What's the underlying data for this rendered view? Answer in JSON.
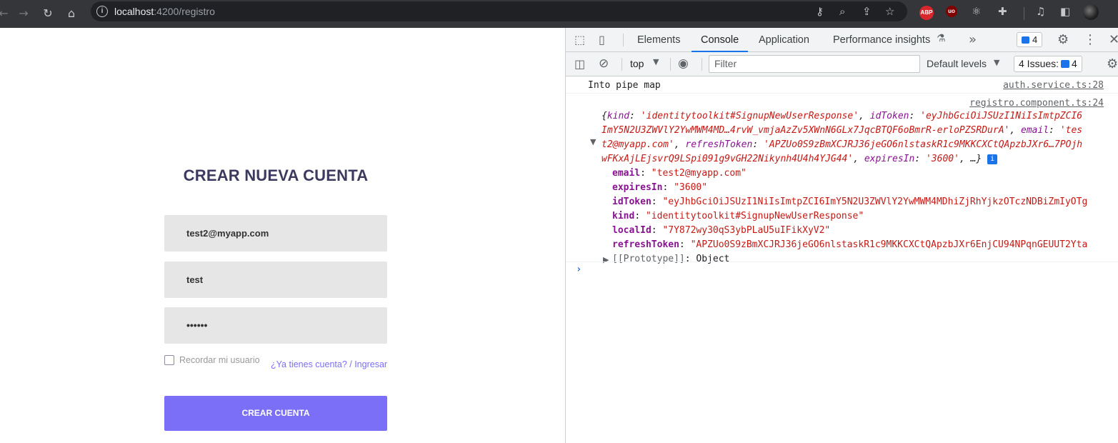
{
  "browser": {
    "url_host": "localhost",
    "url_path": ":4200/registro"
  },
  "form": {
    "title": "CREAR NUEVA CUENTA",
    "email_value": "test2@myapp.com",
    "name_value": "test",
    "password_value": "••••••",
    "remember_label": "Recordar mi usuario",
    "login_link": "¿Ya tienes cuenta? / Ingresar",
    "submit_label": "CREAR CUENTA"
  },
  "devtools": {
    "tabs": [
      "Elements",
      "Console",
      "Application",
      "Performance insights"
    ],
    "message_count": "4",
    "context": "top",
    "filter_placeholder": "Filter",
    "levels": "Default levels",
    "issues_label": "4 Issues:",
    "issues_count": "4"
  },
  "console": {
    "log1_text": "Into pipe map",
    "log1_source": "auth.service.ts:28",
    "log2_source": "registro.component.ts:24",
    "summary": {
      "line1_kind_key": "kind",
      "line1_kind_val": "'identitytoolkit#SignupNewUserResponse'",
      "line1_idtoken_key": "idToken",
      "line1_idtoken_val": "'eyJhbGciOiJSUzI1NiIsImtpZCI6",
      "line2_val": "ImY5N2U3ZWVlY2YwMWM4MD…4rvW_vmjaAzZv5XWnN6GLx7JqcBTQF6oBmrR-erloPZSRDurA'",
      "line2_email_key": "email",
      "line2_email_val": "'tes",
      "line3_val": "t2@myapp.com'",
      "line3_refresh_key": "refreshToken",
      "line3_refresh_val": "'APZUo0S9zBmXCJRJ36jeGO6nlstaskR1c9MKKCXCtQApzbJXr6…7POjh",
      "line4_val": "wFKxAjLEjsvrQ9LSpi091g9vGH22Nikynh4U4h4YJG44'",
      "line4_expires_key": "expiresIn",
      "line4_expires_val": "'3600'",
      "line4_tail": ", …}"
    },
    "props": [
      {
        "key": "email",
        "value": "\"test2@myapp.com\""
      },
      {
        "key": "expiresIn",
        "value": "\"3600\""
      },
      {
        "key": "idToken",
        "value": "\"eyJhbGciOiJSUzI1NiIsImtpZCI6ImY5N2U3ZWVlY2YwMWM4MDhiZjRhYjkzOTczNDBiZmIyOTg"
      },
      {
        "key": "kind",
        "value": "\"identitytoolkit#SignupNewUserResponse\""
      },
      {
        "key": "localId",
        "value": "\"7Y872wy30qS3ybPLaU5uIFikXyV2\""
      },
      {
        "key": "refreshToken",
        "value": "\"APZUo0S9zBmXCJRJ36jeGO6nlstaskR1c9MKKCXCtQApzbJXr6EnjCU94NPqnGEUUT2Yta"
      }
    ],
    "prototype_key": "[[Prototype]]",
    "prototype_val": "Object"
  }
}
